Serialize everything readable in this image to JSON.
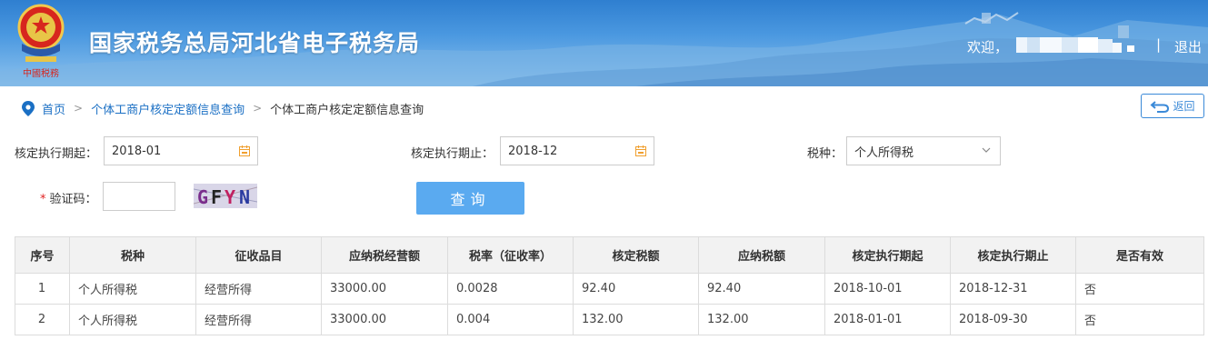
{
  "header": {
    "title": "国家税务总局河北省电子税务局",
    "emblem_caption": "中國税務",
    "welcome": "欢迎，",
    "separator": "|",
    "logout": "退出"
  },
  "breadcrumb": {
    "home": "首页",
    "crumbs": [
      "个体工商户核定定额信息查询",
      "个体工商户核定定额信息查询"
    ],
    "arrow": ">"
  },
  "back_button": {
    "label": "返回"
  },
  "form": {
    "start_label": "核定执行期起：",
    "start_value": "2018-01",
    "end_label": "核定执行期止：",
    "end_value": "2018-12",
    "tax_type_label": "税种：",
    "tax_type_value": "个人所得税",
    "captcha_label": "验证码：",
    "captcha_required": "*",
    "captcha_value": "",
    "captcha_image_text": "GFYN",
    "query_label": "查询"
  },
  "table": {
    "columns": [
      "序号",
      "税种",
      "征收品目",
      "应纳税经营额",
      "税率（征收率）",
      "核定税额",
      "应纳税额",
      "核定执行期起",
      "核定执行期止",
      "是否有效"
    ],
    "rows": [
      [
        "1",
        "个人所得税",
        "经营所得",
        "33000.00",
        "0.0028",
        "92.40",
        "92.40",
        "2018-10-01",
        "2018-12-31",
        "否"
      ],
      [
        "2",
        "个人所得税",
        "经营所得",
        "33000.00",
        "0.004",
        "132.00",
        "132.00",
        "2018-01-01",
        "2018-09-30",
        "否"
      ]
    ]
  },
  "colors": {
    "header_blue": "#2f7fd0",
    "link_blue": "#1a6fc4",
    "button_blue": "#5aaaf0",
    "required_red": "#e02020",
    "table_header_bg": "#f2f2f2"
  }
}
